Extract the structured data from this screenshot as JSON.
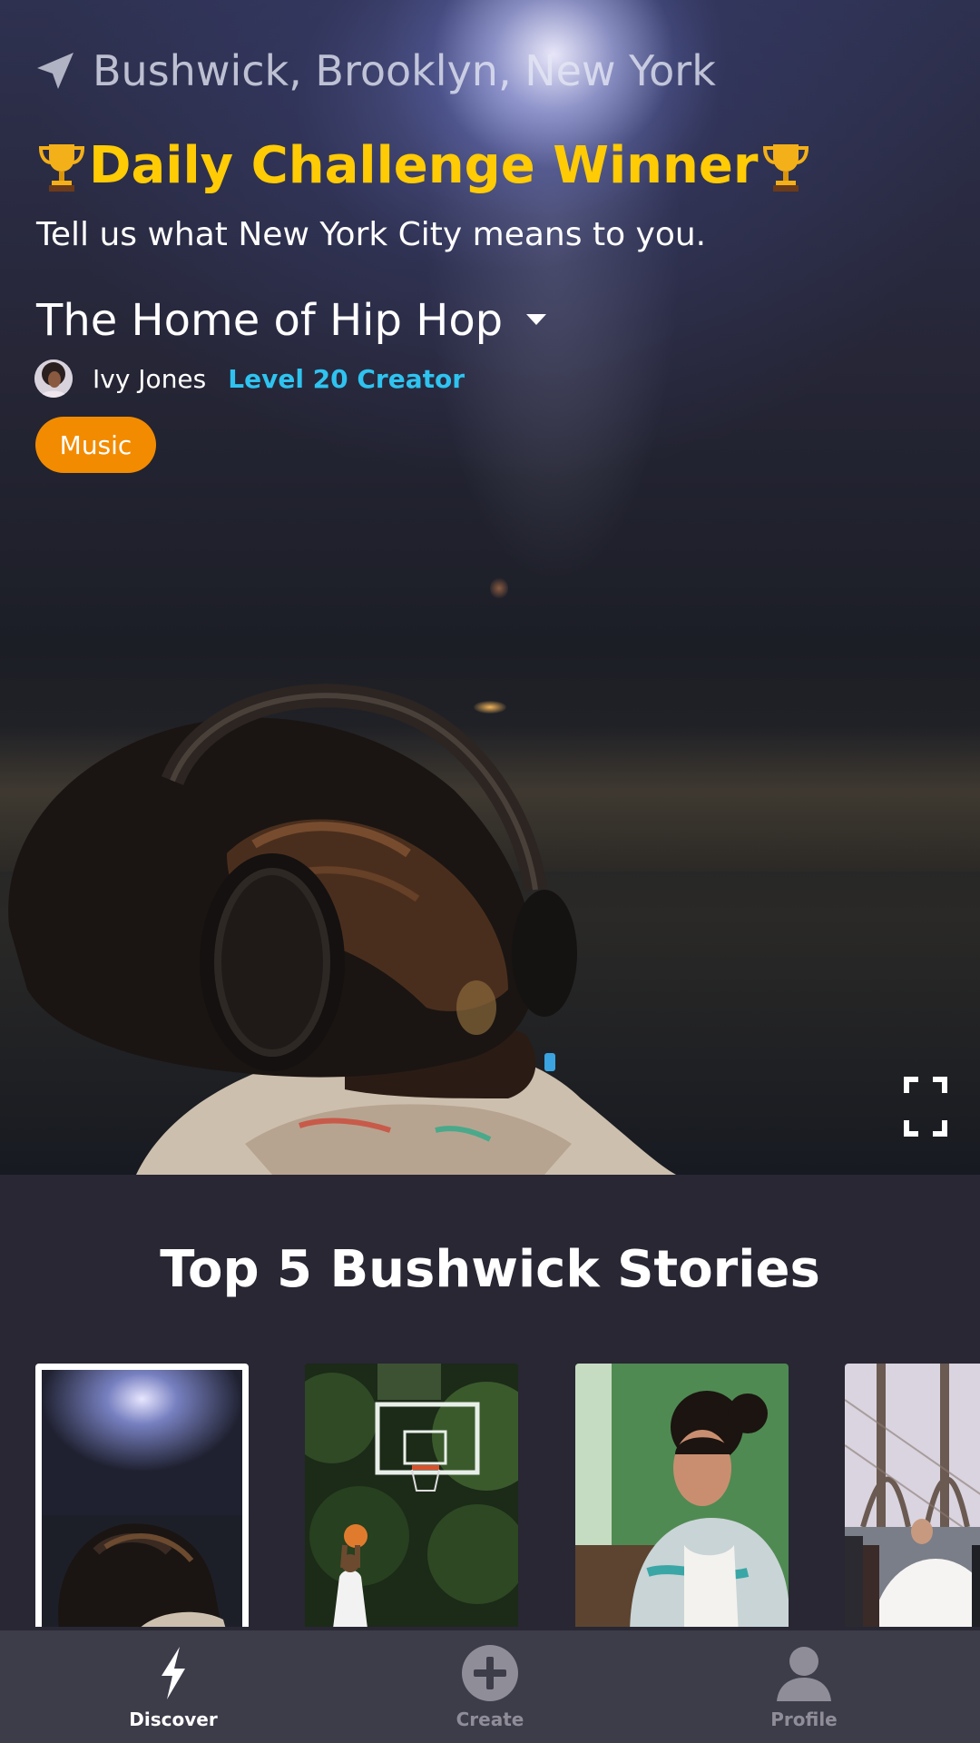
{
  "hero": {
    "location": "Bushwick, Brooklyn, New York",
    "title": "Daily Challenge Winner",
    "prompt": "Tell us what New York City means to you.",
    "story_title": "The Home of Hip Hop",
    "author_name": "Ivy Jones",
    "author_level": "Level 20 Creator",
    "tag": "Music"
  },
  "section": {
    "title": "Top 5 Bushwick Stories"
  },
  "nav": {
    "items": [
      {
        "label": "Discover",
        "icon": "lightning-icon",
        "active": true
      },
      {
        "label": "Create",
        "icon": "plus-circle-icon",
        "active": false
      },
      {
        "label": "Profile",
        "icon": "person-icon",
        "active": false
      }
    ]
  },
  "colors": {
    "title_yellow": "#ffcb05",
    "level_blue": "#2fc3ef",
    "tag_orange": "#f28b00",
    "background": "#282733",
    "nav_bg": "#3d3c49"
  }
}
